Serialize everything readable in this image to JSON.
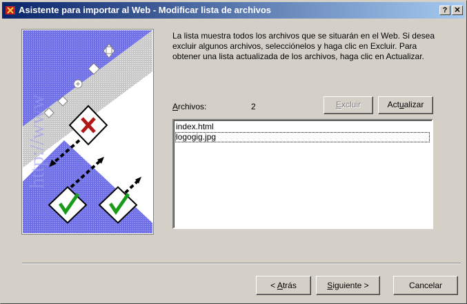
{
  "window": {
    "title": "Asistente para importar al Web - Modificar lista de archivos",
    "help_label": "?",
    "close_label": "✕"
  },
  "description": "La lista muestra todos los archivos que se situarán en el Web. Si desea excluir algunos archivos, selecciónelos y haga clic en Excluir. Para obtener una lista actualizada de los archivos, haga clic en Actualizar.",
  "files": {
    "label_prefix": "",
    "label_accel": "A",
    "label_rest": "rchivos:",
    "count": "2",
    "items": [
      "index.html",
      "logogig.jpg"
    ]
  },
  "buttons": {
    "excluir": {
      "accel": "E",
      "rest": "xcluir"
    },
    "actualizar": {
      "pre": "Act",
      "accel": "u",
      "rest": "alizar"
    },
    "back": {
      "pre": "< ",
      "accel": "A",
      "rest": "trás"
    },
    "next": {
      "pre": "",
      "accel": "S",
      "rest": "iguiente >"
    },
    "cancel": "Cancelar"
  },
  "illustration": {
    "watermark": "http://www",
    "icons": [
      "copy-icon",
      "triangle-icon",
      "circle-plus-icon",
      "file-x-icon",
      "file-check-icon"
    ],
    "colors": {
      "accent": "#6060e0",
      "x_mark": "#b01818",
      "check": "#1a9a1a",
      "title_gradient_start": "#0a246a",
      "title_gradient_end": "#a6caf0"
    }
  }
}
